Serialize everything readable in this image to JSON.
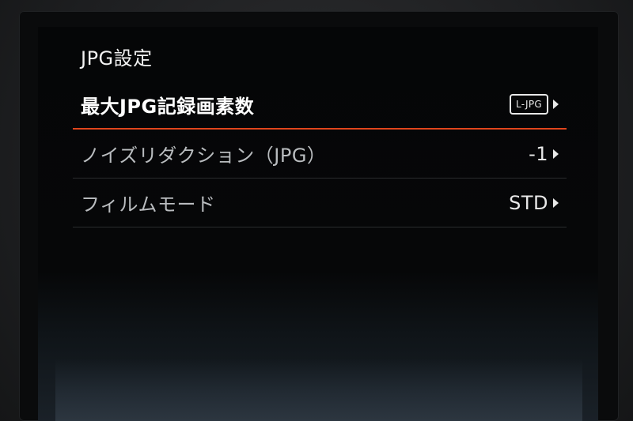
{
  "menu": {
    "title": "JPG設定",
    "items": [
      {
        "label": "最大JPG記録画素数",
        "value_type": "badge",
        "value": "L-JPG",
        "selected": true
      },
      {
        "label": "ノイズリダクション（JPG）",
        "value_type": "text",
        "value": "-1",
        "selected": false
      },
      {
        "label": "フィルムモード",
        "value_type": "text",
        "value": "STD",
        "selected": false
      }
    ]
  },
  "colors": {
    "accent": "#e0451c",
    "text": "#e8e8e8",
    "background": "#050607"
  },
  "icons": {
    "arrow": "chevron-right-icon",
    "badge": "jpg-size-icon"
  }
}
